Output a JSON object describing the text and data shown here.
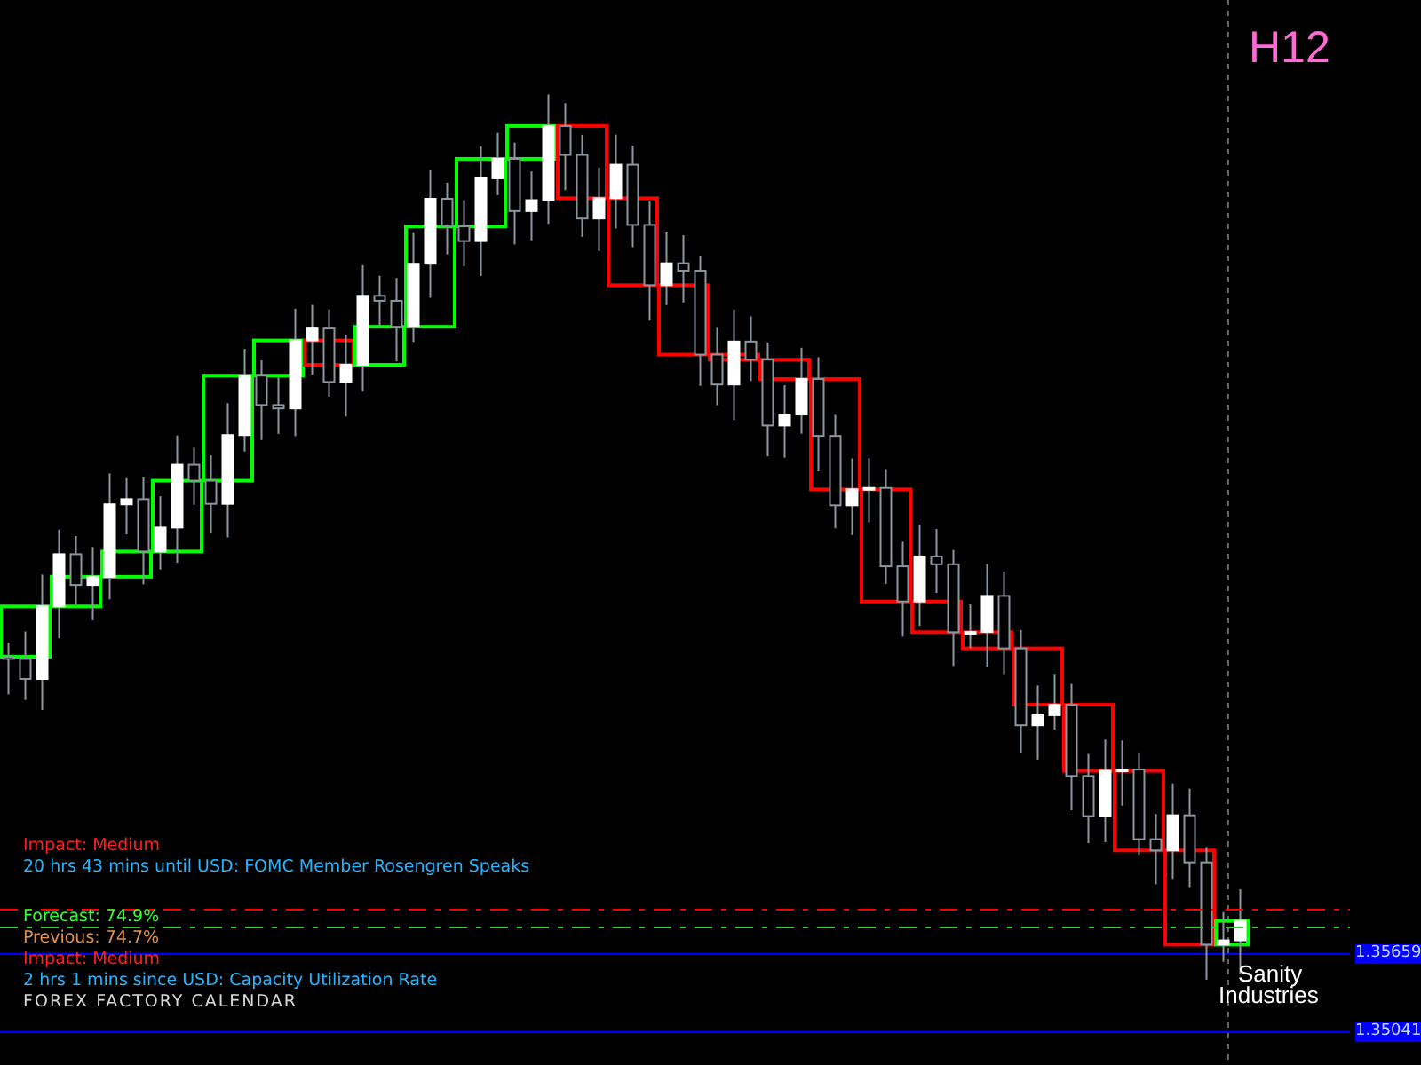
{
  "timeframe": "H12",
  "upcoming_event": {
    "impact": "Impact: Medium",
    "countdown": "20 hrs 43 mins until USD: FOMC Member Rosengren Speaks"
  },
  "forecast": "Forecast: 74.9%",
  "previous": "Previous: 74.7%",
  "last_event": {
    "impact": "Impact: Medium",
    "countdown": "2 hrs 1 mins since USD: Capacity Utilization Rate"
  },
  "source": "FOREX FACTORY CALENDAR",
  "logo": [
    "Sanity",
    "Industries"
  ],
  "price_labels": [
    "1.35659",
    "1.35041"
  ]
}
